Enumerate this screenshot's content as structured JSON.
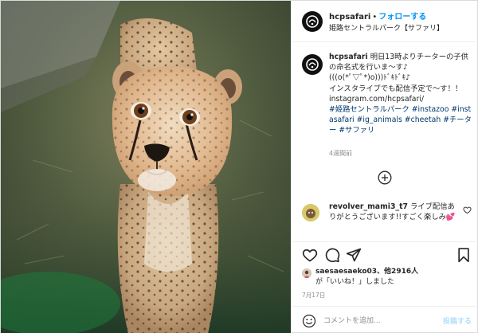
{
  "header": {
    "username": "hcpsafari",
    "separator": "•",
    "follow_label": "フォローする",
    "location": "姫路セントラルパーク【サファリ】",
    "avatar_icon": "safari-park-logo-icon"
  },
  "caption": {
    "username": "hcpsafari",
    "lines": [
      "明日13時よりチーターの子供の命名式を行いま〜す♪",
      "(((o(*ﾟ▽ﾟ*)o)))ﾄﾞｷﾄﾞｷ♪",
      "インスタライブでも配信予定で〜す！！",
      "instagram.com/hcpsafari/"
    ],
    "hashtags": "#姫路セントラルパーク #instazoo #instasafari #ig_animals #cheetah #チーター #サファリ",
    "time_ago": "4週間前"
  },
  "load_more_icon": "plus-circle-icon",
  "comment": {
    "username": "revolver_mami3_t7",
    "text": "ライブ配信ありがとうございます!!すごく楽しみ",
    "emoji": "💕",
    "like_icon": "heart-outline-icon"
  },
  "actions": {
    "icons": [
      "heart-outline-icon",
      "comment-bubble-icon",
      "share-paper-plane-icon",
      "bookmark-icon"
    ]
  },
  "likes": {
    "text_prefix": "saesaesaeko03、他2916人",
    "text_suffix": "が「いいね！」しました"
  },
  "post_date": "7月17日",
  "comment_bar": {
    "emoji_icon": "smiley-face-icon",
    "placeholder": "コメントを追加...",
    "post_label": "投稿する"
  },
  "colors": {
    "link_blue": "#0095f6",
    "hashtag": "#00376b",
    "muted": "#8e8e8e",
    "post_disabled": "#b2dffc"
  }
}
